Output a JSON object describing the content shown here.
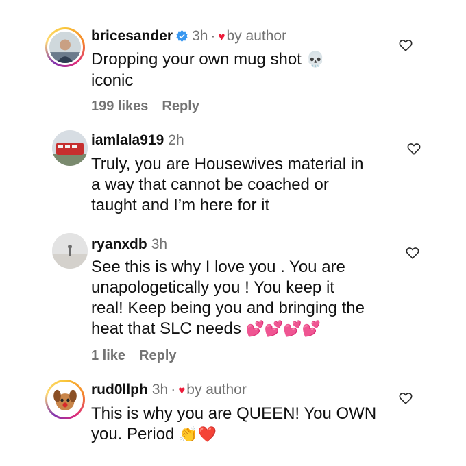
{
  "comments": [
    {
      "username": "bricesander",
      "verified": true,
      "time": "3h",
      "separator": "·",
      "liked_by_author": true,
      "author_label": "by author",
      "text_line1": "Dropping your own mug shot",
      "text_emoji": "💀",
      "text_line2": "iconic",
      "likes": "199 likes",
      "reply": "Reply",
      "avatar": "profile-photo-man-outdoors"
    },
    {
      "username": "iamlala919",
      "time": "2h",
      "text_lines": [
        "Truly, you are Housewives material in",
        "a way that cannot be coached or",
        "taught and I’m here for it"
      ],
      "avatar": "profile-photo-red-train"
    },
    {
      "username": "ryanxdb",
      "time": "3h",
      "text_lines": [
        "See this is why I love you . You are",
        "unapologetically you ! You keep it",
        "real! Keep being you and bringing the"
      ],
      "text_last": "heat that SLC needs",
      "text_emoji": "💕💕💕💕",
      "likes": "1 like",
      "reply": "Reply",
      "avatar": "profile-photo-beach"
    },
    {
      "username": "rud0llph",
      "time": "3h",
      "separator": "·",
      "liked_by_author": true,
      "author_label": "by author",
      "text_line1": "This is why you are QUEEN! You OWN",
      "text_line2": "you. Period",
      "text_emoji": "👏❤️",
      "avatar": "profile-photo-cartoon-dog"
    }
  ],
  "colors": {
    "verified_blue": "#3897f0",
    "heart_red": "#ed1c3a",
    "muted_text": "#737373"
  }
}
